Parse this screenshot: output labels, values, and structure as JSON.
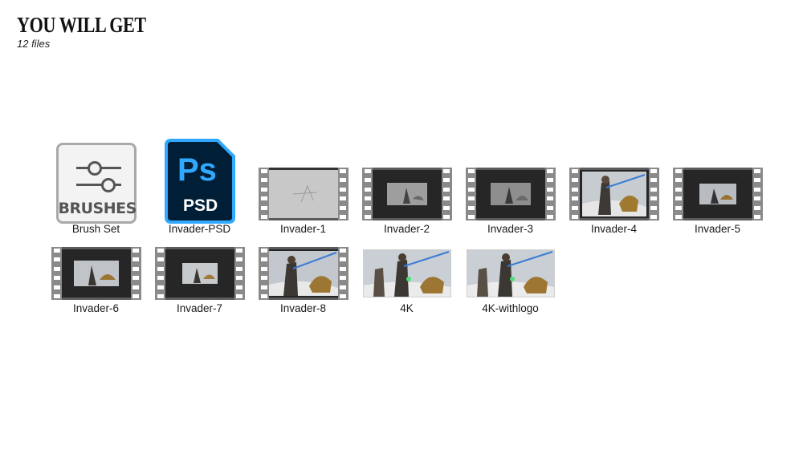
{
  "header": {
    "title": "YOU WILL GET",
    "subtitle": "12 files"
  },
  "files": [
    {
      "label": "Brush Set",
      "icon": "brush-set-icon",
      "icon_text": "BRUSHES"
    },
    {
      "label": "Invader-PSD",
      "icon": "photoshop-file-icon",
      "icon_text": "Ps",
      "icon_subtext": "PSD",
      "accent": "#31a8ff",
      "bg": "#001e36"
    },
    {
      "label": "Invader-1",
      "icon": "video-file-icon"
    },
    {
      "label": "Invader-2",
      "icon": "video-file-icon"
    },
    {
      "label": "Invader-3",
      "icon": "video-file-icon"
    },
    {
      "label": "Invader-4",
      "icon": "video-file-icon"
    },
    {
      "label": "Invader-5",
      "icon": "video-file-icon"
    },
    {
      "label": "Invader-6",
      "icon": "video-file-icon"
    },
    {
      "label": "Invader-7",
      "icon": "video-file-icon"
    },
    {
      "label": "Invader-8",
      "icon": "video-file-icon"
    },
    {
      "label": "4K",
      "icon": "image-file-icon"
    },
    {
      "label": "4K-withlogo",
      "icon": "image-file-icon"
    }
  ]
}
